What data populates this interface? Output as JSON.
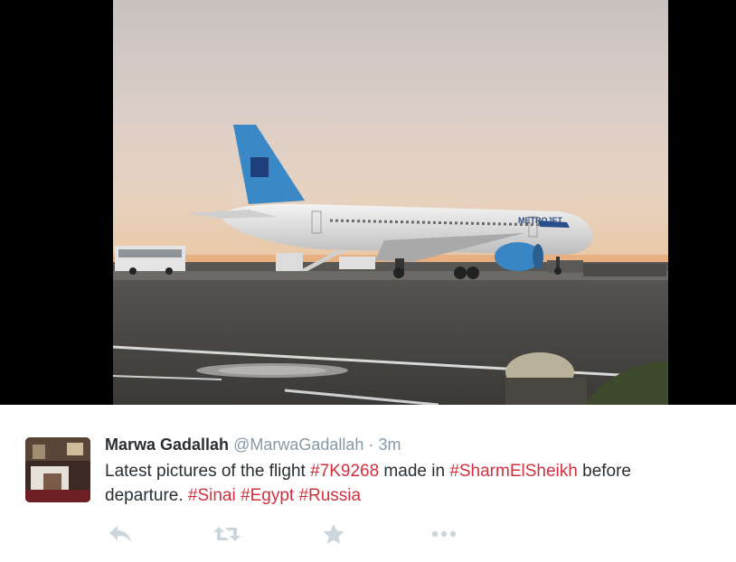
{
  "tweet": {
    "author_name": "Marwa Gadallah",
    "handle": "@MarwaGadallah",
    "separator": "·",
    "time": "3m",
    "text_parts": [
      {
        "text": "Latest pictures of the flight ",
        "type": "text"
      },
      {
        "text": "#7K9268",
        "type": "hashtag"
      },
      {
        "text": " made in ",
        "type": "text"
      },
      {
        "text": "#SharmElSheikh",
        "type": "hashtag"
      },
      {
        "text": " before departure. ",
        "type": "text"
      },
      {
        "text": "#Sinai",
        "type": "hashtag"
      },
      {
        "text": " ",
        "type": "text"
      },
      {
        "text": "#Egypt",
        "type": "hashtag"
      },
      {
        "text": " ",
        "type": "text"
      },
      {
        "text": "#Russia",
        "type": "hashtag"
      }
    ]
  },
  "photo": {
    "airline_text": "METROJET"
  },
  "colors": {
    "hashtag": "#d2303e",
    "name": "#292f33",
    "muted": "#8899a6",
    "action_icon": "#ccd6dd"
  },
  "actions": [
    {
      "name": "reply-icon"
    },
    {
      "name": "retweet-icon"
    },
    {
      "name": "favorite-icon"
    },
    {
      "name": "more-icon"
    }
  ]
}
